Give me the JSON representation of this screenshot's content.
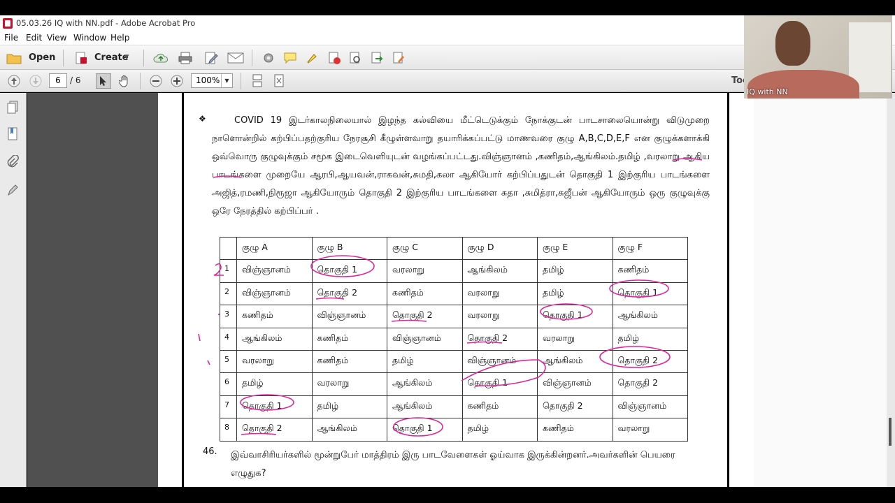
{
  "window": {
    "title": "05.03.26 IQ  with NN.pdf - Adobe Acrobat Pro"
  },
  "menu": [
    "File",
    "Edit",
    "View",
    "Window",
    "Help"
  ],
  "toolbar": {
    "open_label": "Open",
    "create_label": "Create"
  },
  "navigation": {
    "current_page": "6",
    "total_pages": "/ 6",
    "zoom": "100%",
    "tools_label": "Too"
  },
  "webcam": {
    "label": "IQ with NN"
  },
  "document": {
    "bullet": "❖",
    "paragraph": "COVID 19 இடர்காலநிலையால் இழந்த கல்வியை மீட்டெடுக்கும்  நோக்குடன் பாடசாலையொன்று விடுமுறை நாளொன்றில் கற்பிப்பதற்குரிய நேரசூசி கீழுள்ளவாறு தயாரிக்கப்பட்டு மாணவரை குழு A,B,C,D,E,F என குழுக்களாக்கி ஒவ்வொரு குழுவுக்கும் சமூக இடைவெளியுடன் வழங்கப்பட்டது.விஞ்ஞானம் ,கணிதம்,ஆங்கிலம்.தமிழ் ,வரலாறு ஆகிய பாடங்களை முறையே ஆரபி,ஆயவன்,ராகவன்,சுமதி,கலா ஆகியோர் கற்பிப்பதுடன் தொகுதி 1 இற்குரிய பாடங்களை அஜித்,ரமணி,நிரூஜா ஆகியோரும் தொகுதி 2 இற்குரிய பாடங்களை சுதா ,சுமித்ரா,சுஜீபன் ஆகியோரும் ஒரு குழுவுக்கு ஒரே நேரத்தில் கற்பிப்பர் .",
    "table": {
      "headers": [
        "",
        "குழு A",
        "குழு B",
        "குழு C",
        "குழு D",
        "குழு E",
        "குழு F"
      ],
      "rows": [
        [
          "1",
          "விஞ்ஞானம்",
          "தொகுதி 1",
          "வரலாறு",
          "ஆங்கிலம்",
          "தமிழ்",
          "கணிதம்"
        ],
        [
          "2",
          "விஞ்ஞானம்",
          "தொகுதி 2",
          "கணிதம்",
          "வரலாறு",
          "தமிழ்",
          "தொகுதி 1"
        ],
        [
          "3",
          "கணிதம்",
          "விஞ்ஞானம்",
          "தொகுதி 2",
          "வரலாறு",
          "தொகுதி 1",
          "ஆங்கிலம்"
        ],
        [
          "4",
          "ஆங்கிலம்",
          "கணிதம்",
          "விஞ்ஞானம்",
          "தொகுதி 2",
          "வரலாறு",
          "தமிழ்"
        ],
        [
          "5",
          "வரலாறு",
          "கணிதம்",
          "தமிழ்",
          "விஞ்ஞானம்",
          "ஆங்கிலம்",
          "தொகுதி 2"
        ],
        [
          "6",
          "தமிழ்",
          "வரலாறு",
          "ஆங்கிலம்",
          "தொகுதி 1",
          "விஞ்ஞானம்",
          "தொகுதி 2"
        ],
        [
          "7",
          "தொகுதி 1",
          "தமிழ்",
          "ஆங்கிலம்",
          "கணிதம்",
          "தொகுதி 2",
          "விஞ்ஞானம்"
        ],
        [
          "8",
          "தொகுதி 2",
          "ஆங்கிலம்",
          "தொகுதி 1",
          "தமிழ்",
          "கணிதம்",
          "வரலாறு"
        ]
      ]
    },
    "question_number": "46.",
    "question_text": "இவ்வாசிரியர்களில் மூன்றுபேர் மாத்திரம் இரு பாடவேளைகள் ஓய்வாக இருக்கின்றனர்.அவர்களின் பெயரை எழுதுக?"
  },
  "colors": {
    "annotation": "#e0259c",
    "pdf_brand": "#c8102e"
  }
}
